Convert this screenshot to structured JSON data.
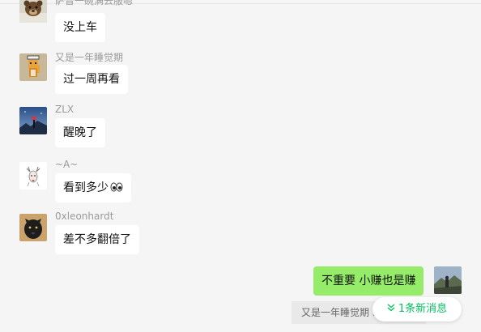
{
  "messages": [
    {
      "sender": "萨普一碗满去服嗯",
      "text": "没上车",
      "avatar_icon": "bear-avatar-icon"
    },
    {
      "sender": "又是一年睡觉期",
      "text": "过一周再看",
      "avatar_icon": "pixel-art-avatar-icon"
    },
    {
      "sender": "ZLX",
      "text": "醒晚了",
      "avatar_icon": "night-sky-avatar-icon"
    },
    {
      "sender": "~A~",
      "text": "看到多少",
      "emoji": "eyes-emoji",
      "avatar_icon": "deer-sketch-avatar-icon"
    },
    {
      "sender": "0xleonhardt",
      "text": "差不多翻倍了",
      "avatar_icon": "black-dog-avatar-icon"
    }
  ],
  "self_message": {
    "text": "不重要 小赚也是赚",
    "avatar_icon": "mountain-photo-avatar-icon"
  },
  "notice": {
    "text": "又是一年睡觉期 ..."
  },
  "new_messages": {
    "label": "1条新消息",
    "icon": "double-chevron-down-icon"
  },
  "colors": {
    "background": "#f5f5f5",
    "bubble_other": "#ffffff",
    "bubble_self": "#95ec69",
    "accent": "#07c160",
    "sender_name": "#9a9a9a"
  }
}
